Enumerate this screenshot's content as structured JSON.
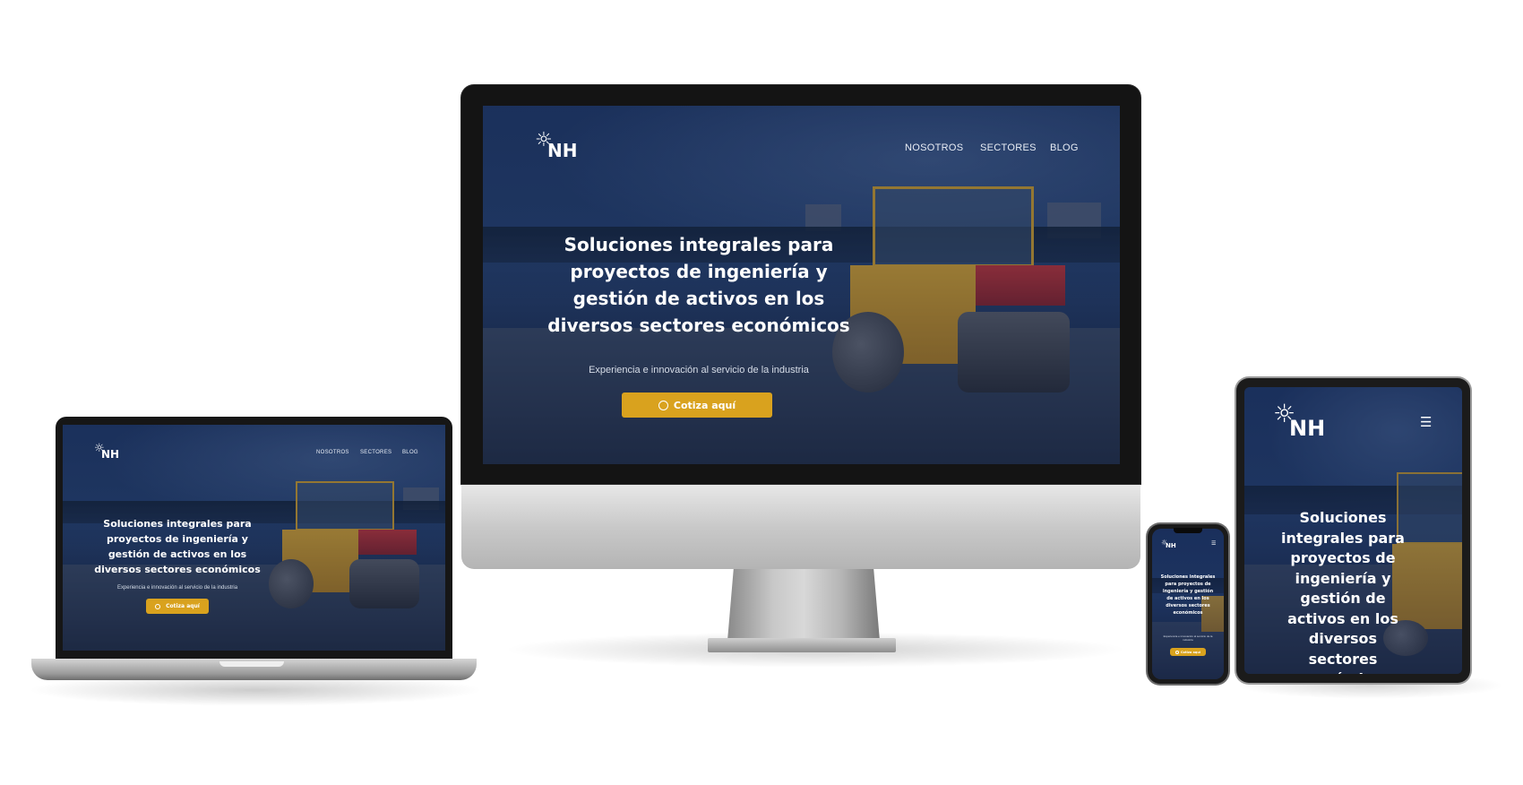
{
  "brand": {
    "logo_text": "NH",
    "logo_icon": "sunburst-icon"
  },
  "nav": {
    "items": [
      "NOSOTROS",
      "SECTORES",
      "BLOG"
    ],
    "menu_icon": "hamburger-icon"
  },
  "hero": {
    "title": "Soluciones integrales para proyectos de ingeniería y gestión de activos en los diversos sectores económicos",
    "subtitle": "Experiencia e innovación al servicio de la industria",
    "cta_label": "Cotiza aquí",
    "cta_icon": "whatsapp-icon"
  },
  "colors": {
    "accent": "#d9a21e",
    "overlay": "#1c3464",
    "text": "#ffffff"
  },
  "devices": [
    "desktop",
    "laptop",
    "phone",
    "tablet"
  ]
}
